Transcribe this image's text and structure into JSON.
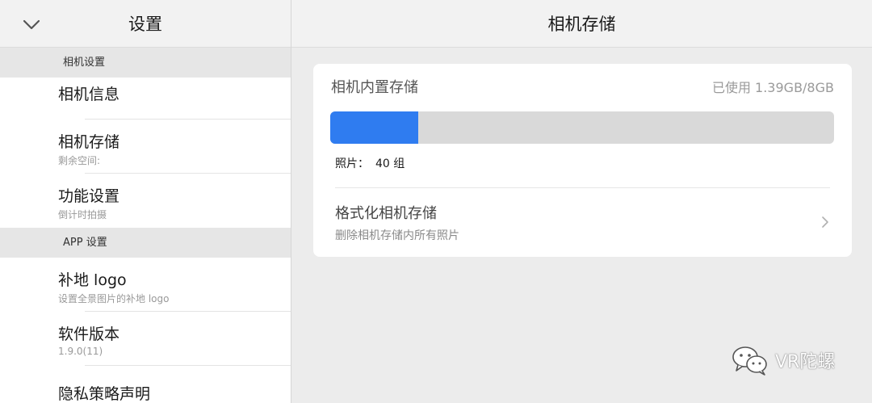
{
  "sidebar": {
    "title": "设置",
    "sections": [
      {
        "header": "相机设置",
        "items": [
          {
            "label": "相机信息",
            "sub": ""
          },
          {
            "label": "相机存储",
            "sub": "剩余空间:"
          },
          {
            "label": "功能设置",
            "sub": "倒计时拍摄"
          }
        ]
      },
      {
        "header": "APP 设置",
        "items": [
          {
            "label": "补地 logo",
            "sub": "设置全景图片的补地 logo"
          },
          {
            "label": "软件版本",
            "sub": "1.9.0(11)"
          },
          {
            "label": "隐私策略声明",
            "sub": ""
          }
        ]
      }
    ]
  },
  "main": {
    "title": "相机存储",
    "storage": {
      "label": "相机内置存储",
      "used": "已使用 1.39GB/8GB",
      "used_fraction": 0.174,
      "photos_label": "照片：",
      "photos_value": "40 组"
    },
    "format": {
      "title": "格式化相机存储",
      "subtitle": "删除相机存储内所有照片"
    }
  },
  "watermark": {
    "text": "VR陀螺"
  },
  "colors": {
    "accent": "#2f7cf0",
    "track": "#d9d9d9",
    "header_bg": "#f2f2f2",
    "section_bg": "#e6e6e6",
    "page_bg": "#ececec"
  },
  "icons": {
    "back": "chevron-down-icon",
    "row": "chevron-right-icon",
    "watermark": "wechat-logo-icon"
  }
}
